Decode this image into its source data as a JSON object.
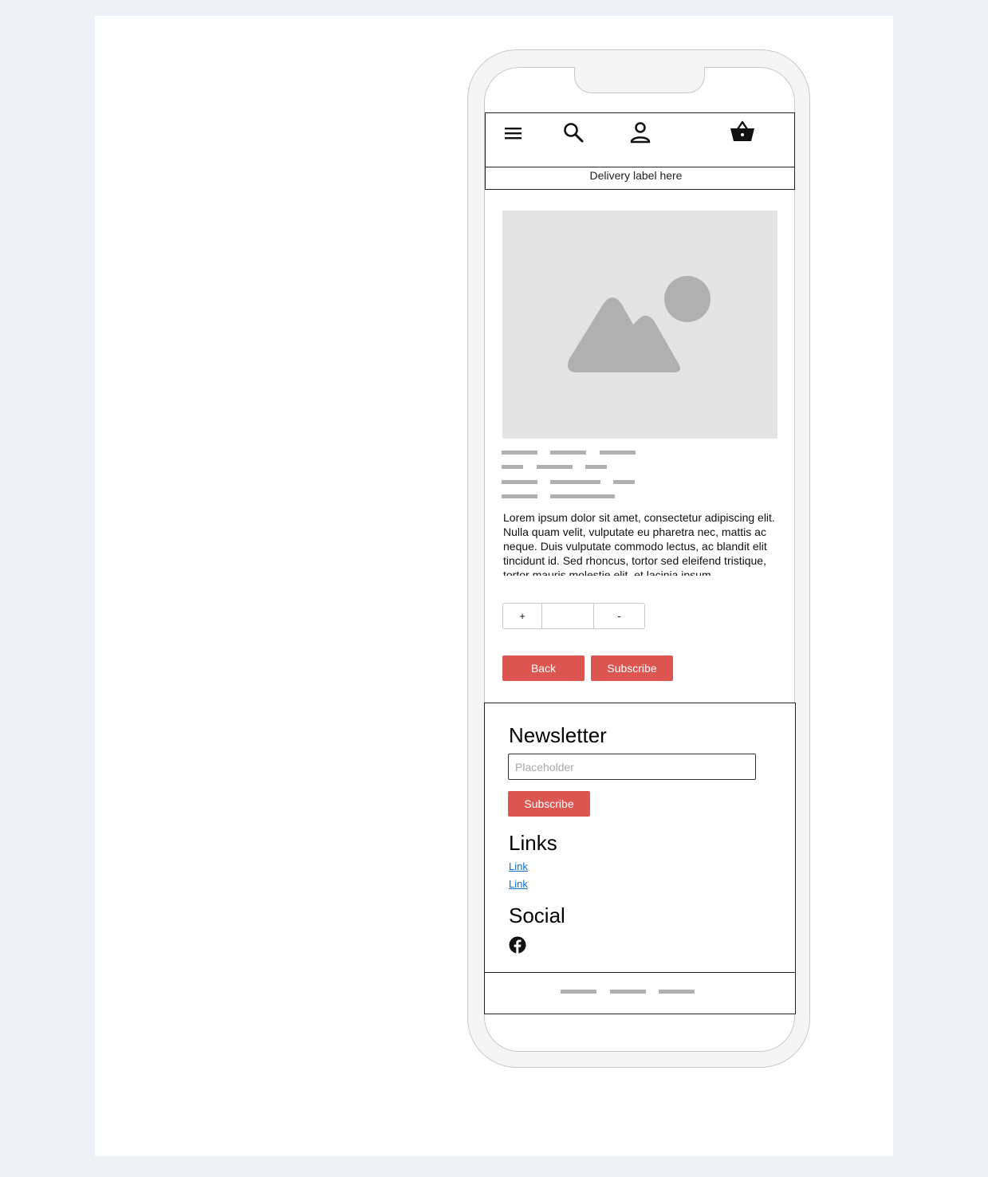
{
  "header": {
    "icons": [
      "menu-icon",
      "search-icon",
      "user-icon",
      "basket-icon"
    ]
  },
  "delivery": {
    "label": "Delivery label here"
  },
  "product": {
    "image_icon": "image-placeholder-icon",
    "description": "Lorem ipsum dolor sit amet, consectetur adipiscing elit. Nulla quam velit, vulputate eu pharetra nec, mattis ac neque. Duis vulputate commodo lectus, ac blandit elit tincidunt id. Sed rhoncus, tortor sed eleifend tristique, tortor mauris molestie elit, et lacinia ipsum"
  },
  "stepper": {
    "plus_label": "+",
    "quantity": "",
    "minus_label": "-"
  },
  "actions": {
    "back_label": "Back",
    "subscribe_label": "Subscribe"
  },
  "footer": {
    "newsletter_heading": "Newsletter",
    "newsletter_placeholder": "Placeholder",
    "newsletter_button": "Subscribe",
    "links_heading": "Links",
    "links": [
      "Link",
      "Link"
    ],
    "social_heading": "Social",
    "social_icons": [
      "facebook-icon"
    ]
  },
  "colors": {
    "accent": "#dc5550",
    "link": "#0b6fd0",
    "placeholder_gray": "#e4e4e4",
    "skeleton_gray": "#b0b0b0"
  }
}
